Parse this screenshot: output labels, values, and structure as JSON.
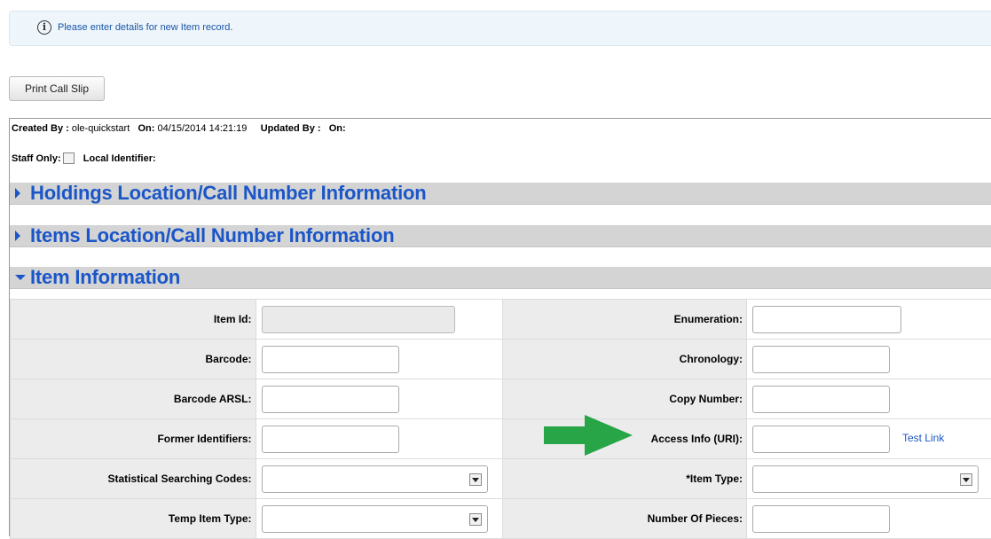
{
  "banner": {
    "message": "Please enter details for new Item record."
  },
  "toolbar": {
    "print_call_slip": "Print Call Slip"
  },
  "meta": {
    "created_by_label": "Created By :",
    "created_by_value": "ole-quickstart",
    "on_label": "On:",
    "on_value": "04/15/2014 14:21:19",
    "updated_by_label": "Updated By :",
    "updated_on_label": "On:",
    "staff_only_label": "Staff Only:",
    "local_identifier_label": "Local Identifier:"
  },
  "sections": {
    "holdings": "Holdings Location/Call Number Information",
    "items": "Items Location/Call Number Information",
    "item_info": "Item Information"
  },
  "fields": {
    "item_id": "Item Id:",
    "barcode": "Barcode:",
    "barcode_arsl": "Barcode ARSL:",
    "former_identifiers": "Former Identifiers:",
    "statistical_searching_codes": "Statistical Searching Codes:",
    "temp_item_type": "Temp Item Type:",
    "enumeration": "Enumeration:",
    "chronology": "Chronology:",
    "copy_number": "Copy Number:",
    "access_info": "Access Info (URI):",
    "item_type": "*Item Type:",
    "number_of_pieces": "Number Of Pieces:"
  },
  "links": {
    "test_link": "Test Link"
  },
  "colors": {
    "accent": "#1a56c8",
    "arrow": "#27a547",
    "banner_bg": "#eef5fb"
  }
}
